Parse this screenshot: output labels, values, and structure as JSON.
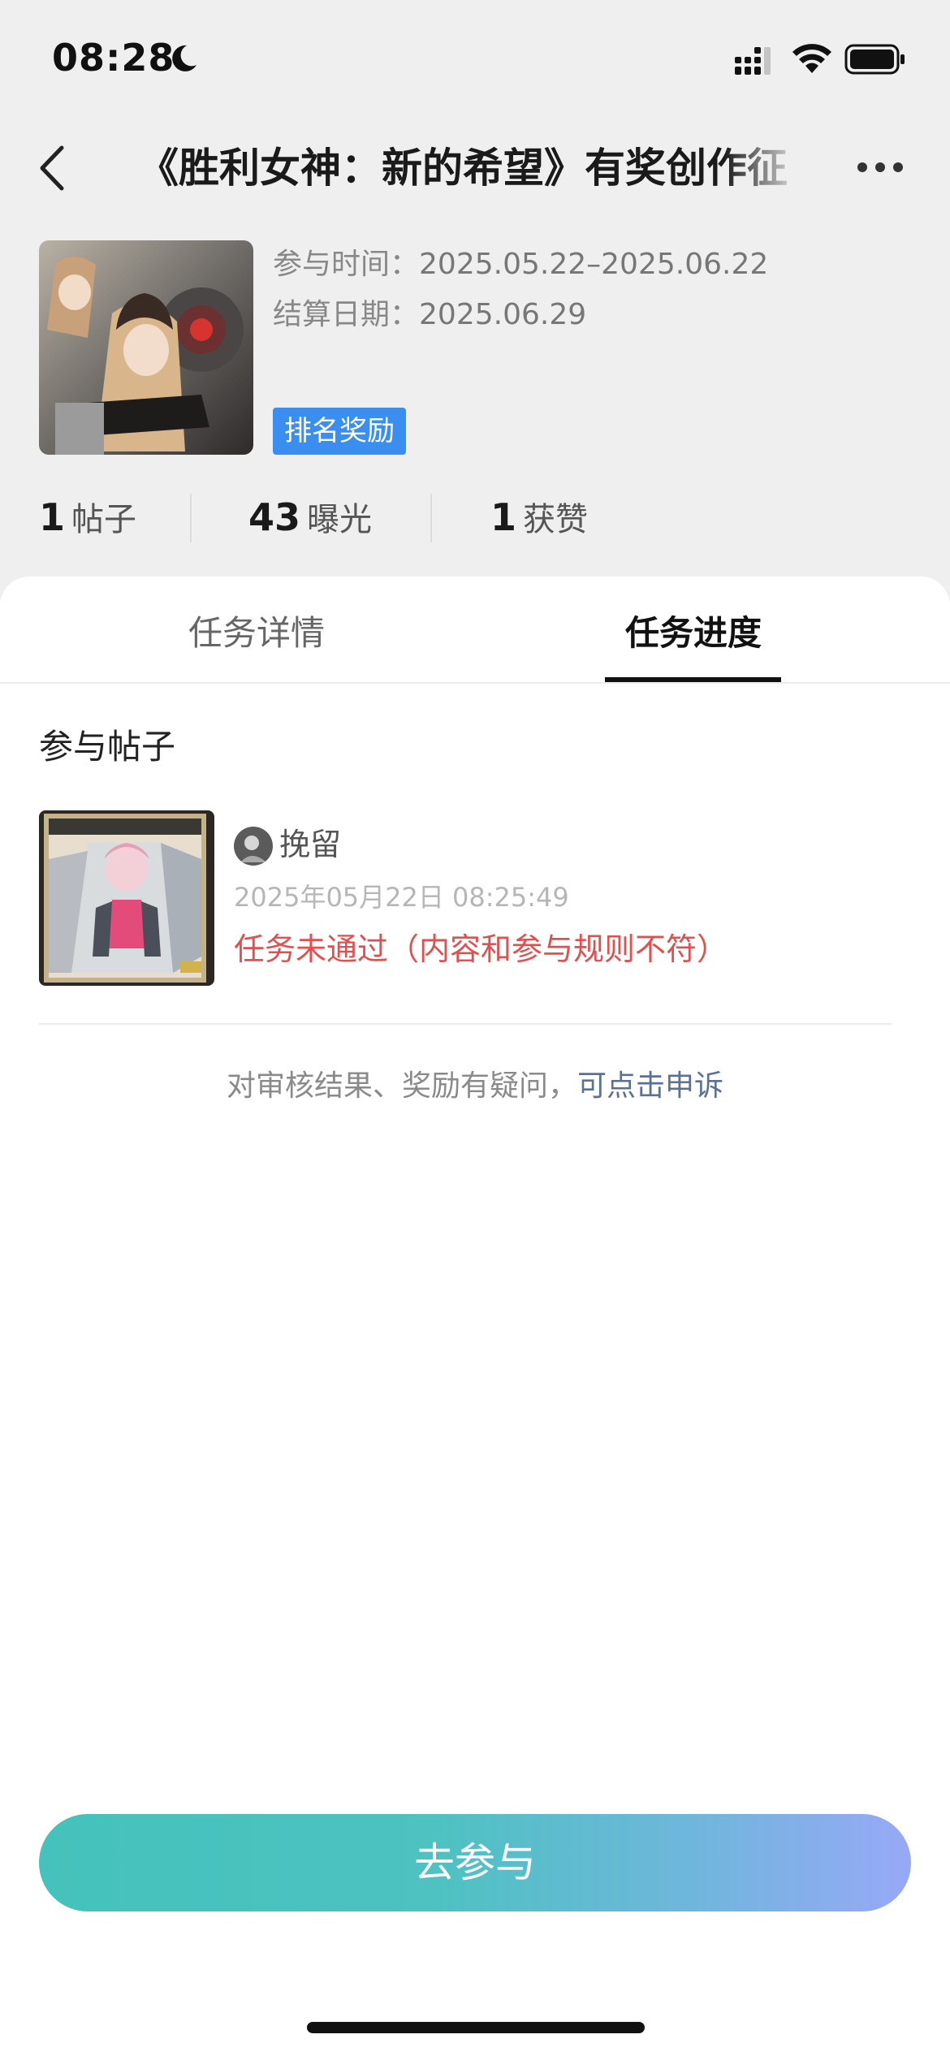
{
  "status_bar": {
    "time": "08:28",
    "icons": [
      "moon-icon",
      "signal-icon",
      "wifi-icon",
      "battery-icon"
    ]
  },
  "nav": {
    "title": "《胜利女神：新的希望》有奖创作征",
    "back_icon": "chevron-left-icon",
    "more_icon": "more-dots-icon"
  },
  "campaign": {
    "time_label": "参与时间：",
    "time_value": "2025.05.22–2025.06.22",
    "settle_label": "结算日期：",
    "settle_value": "2025.06.29",
    "badge": "排名奖励"
  },
  "stats": [
    {
      "value": "1",
      "label": "帖子"
    },
    {
      "value": "43",
      "label": "曝光"
    },
    {
      "value": "1",
      "label": "获赞"
    }
  ],
  "tabs": [
    {
      "label": "任务详情",
      "active": false
    },
    {
      "label": "任务进度",
      "active": true
    }
  ],
  "section_title": "参与帖子",
  "post": {
    "author": "挽留",
    "time": "2025年05月22日 08:25:49",
    "status": "任务未通过（内容和参与规则不符）"
  },
  "appeal": {
    "text": "对审核结果、奖励有疑问，",
    "link": "可点击申诉"
  },
  "cta": {
    "label": "去参与"
  },
  "colors": {
    "header_bg": "#efefef",
    "badge_bg": "#3a8ef0",
    "status_fail": "#e0504f",
    "appeal_link": "#5b7194",
    "cta_gradient_start": "#45c2bb",
    "cta_gradient_end": "#98a8f7"
  }
}
